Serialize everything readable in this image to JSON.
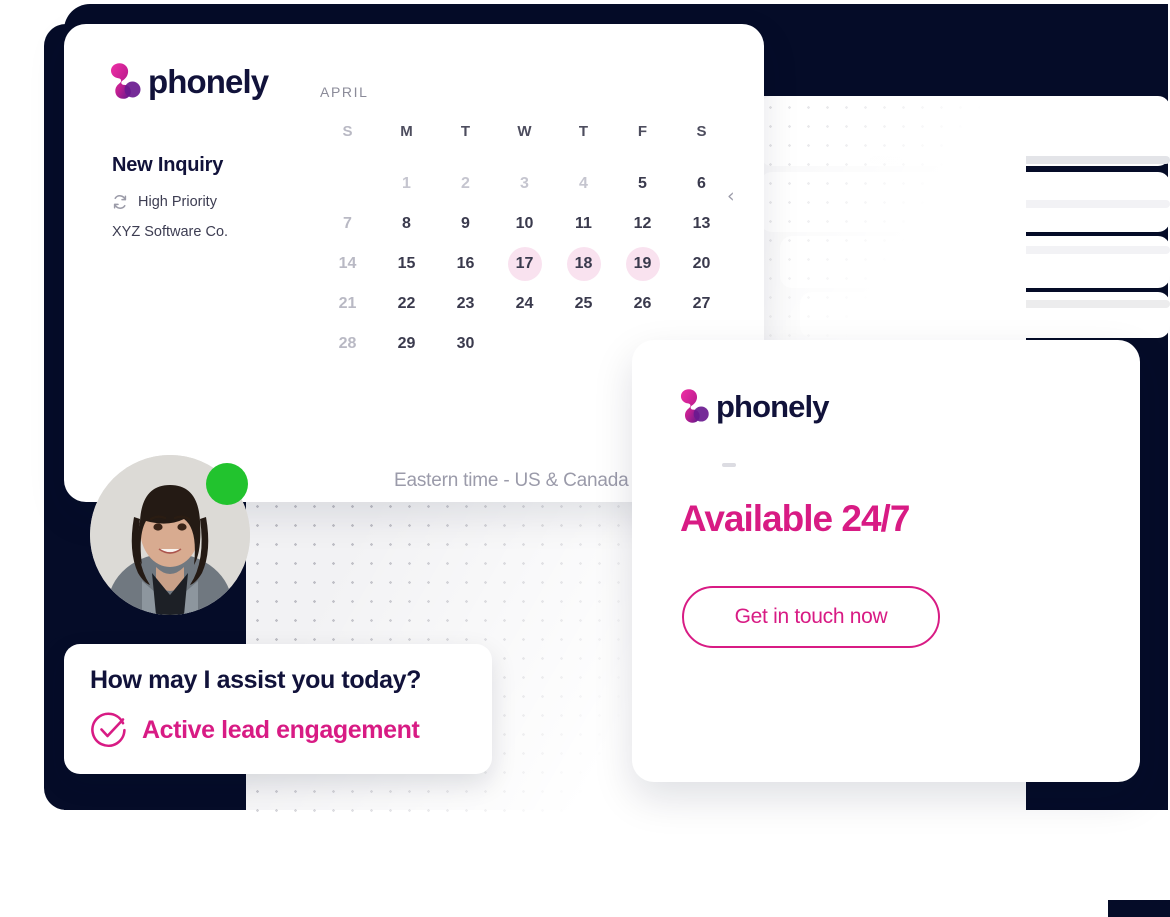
{
  "brand": {
    "name": "phonely",
    "accent": "#d81b84",
    "logo_gradient_start": "#e8299b",
    "logo_gradient_end": "#5b1a8c",
    "navy": "#050c28",
    "online_green": "#22c32e"
  },
  "main_card": {
    "inquiry_title": "New Inquiry",
    "priority_label": "High Priority",
    "priority_icon": "refresh-icon",
    "company": "XYZ Software Co."
  },
  "calendar": {
    "month": "APRIL",
    "prev_icon": "chevron-left-icon",
    "next_icon": "chevron-right-icon",
    "weekdays": [
      "S",
      "M",
      "T",
      "W",
      "T",
      "F",
      "S"
    ],
    "weekday_dim_index": 0,
    "weeks": [
      [
        {
          "day": "",
          "state": "empty"
        },
        {
          "day": "1",
          "state": "muted"
        },
        {
          "day": "2",
          "state": "muted"
        },
        {
          "day": "3",
          "state": "muted"
        },
        {
          "day": "4",
          "state": "muted"
        },
        {
          "day": "5",
          "state": "normal"
        },
        {
          "day": "6",
          "state": "normal"
        }
      ],
      [
        {
          "day": "7",
          "state": "dim"
        },
        {
          "day": "8",
          "state": "normal"
        },
        {
          "day": "9",
          "state": "normal"
        },
        {
          "day": "10",
          "state": "normal"
        },
        {
          "day": "11",
          "state": "normal"
        },
        {
          "day": "12",
          "state": "normal"
        },
        {
          "day": "13",
          "state": "normal"
        }
      ],
      [
        {
          "day": "14",
          "state": "dim"
        },
        {
          "day": "15",
          "state": "normal"
        },
        {
          "day": "16",
          "state": "normal"
        },
        {
          "day": "17",
          "state": "highlighted"
        },
        {
          "day": "18",
          "state": "highlighted"
        },
        {
          "day": "19",
          "state": "highlighted"
        },
        {
          "day": "20",
          "state": "normal"
        }
      ],
      [
        {
          "day": "21",
          "state": "dim"
        },
        {
          "day": "22",
          "state": "normal"
        },
        {
          "day": "23",
          "state": "normal"
        },
        {
          "day": "24",
          "state": "normal"
        },
        {
          "day": "25",
          "state": "normal"
        },
        {
          "day": "26",
          "state": "normal"
        },
        {
          "day": "27",
          "state": "normal"
        }
      ],
      [
        {
          "day": "28",
          "state": "dim"
        },
        {
          "day": "29",
          "state": "normal"
        },
        {
          "day": "30",
          "state": "normal"
        },
        {
          "day": "",
          "state": "empty"
        },
        {
          "day": "",
          "state": "empty"
        },
        {
          "day": "",
          "state": "empty"
        },
        {
          "day": "",
          "state": "empty"
        }
      ]
    ],
    "highlight_color": "#f9e2ef"
  },
  "timezone": {
    "selected": "Eastern time - US & Canada",
    "caret_icon": "caret-down-icon"
  },
  "avatar": {
    "alt": "agent-photo",
    "status": "online"
  },
  "chat_card": {
    "question": "How may I assist you today?",
    "status_icon": "check-circle-icon",
    "status_text": "Active lead engagement"
  },
  "right_card": {
    "headline": "Available 24/7",
    "cta_label": "Get in touch now"
  }
}
